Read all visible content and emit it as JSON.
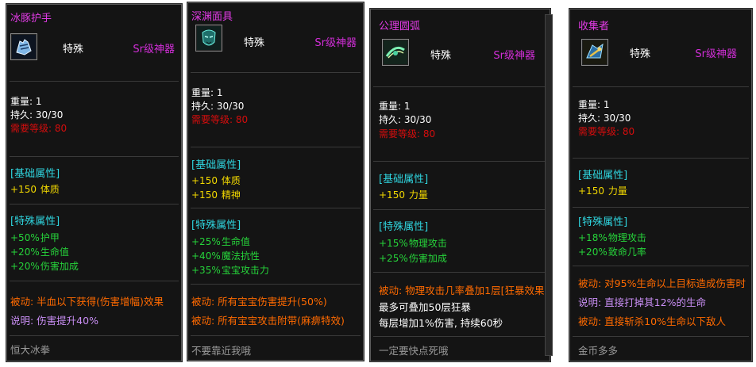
{
  "cards": [
    {
      "title": "冰豚护手",
      "icon": "glove-icon",
      "type": "特殊",
      "rarity": "Sr级神器",
      "weight": "重量: 1",
      "durability": "持久: 30/30",
      "level_req": "需要等级:  80",
      "base_header": "[基础属性]",
      "base_stats": [
        {
          "value": "+150",
          "label": "体质"
        }
      ],
      "special_header": "[特殊属性]",
      "special_stats": [
        {
          "value": "+50%",
          "label": "护甲"
        },
        {
          "value": "+20%",
          "label": "生命值"
        },
        {
          "value": "+20%",
          "label": "伤害加成"
        }
      ],
      "effects": [
        {
          "kind": "orange",
          "text": "被动: 半血以下获得(伤害增幅)效果"
        },
        {
          "kind": "lav",
          "text": "说明: 伤害提升40%"
        }
      ],
      "flavor": "恒大冰拳"
    },
    {
      "title": "深渊面具",
      "icon": "mask-icon",
      "type": "特殊",
      "rarity": "Sr级神器",
      "weight": "重量: 1",
      "durability": "持久: 30/30",
      "level_req": "需要等级:  80",
      "base_header": "[基础属性]",
      "base_stats": [
        {
          "value": "+150",
          "label": "体质"
        },
        {
          "value": "+150",
          "label": "精神"
        }
      ],
      "special_header": "[特殊属性]",
      "special_stats": [
        {
          "value": "+25%",
          "label": "生命值"
        },
        {
          "value": "+40%",
          "label": "魔法抗性"
        },
        {
          "value": "+35%",
          "label": "宝宝攻击力"
        }
      ],
      "effects": [
        {
          "kind": "orange",
          "text": "被动: 所有宝宝伤害提升(50%)"
        },
        {
          "kind": "orange",
          "text": "被动: 所有宝宝攻击附带(麻痹特效)"
        }
      ],
      "flavor": "不要靠近我哦"
    },
    {
      "title": "公理圆弧",
      "icon": "arc-icon",
      "type": "特殊",
      "rarity": "Sr级神器",
      "weight": "重量: 1",
      "durability": "持久: 30/30",
      "level_req": "需要等级:  80",
      "base_header": "[基础属性]",
      "base_stats": [
        {
          "value": "+150",
          "label": "力量"
        }
      ],
      "special_header": "[特殊属性]",
      "special_stats": [
        {
          "value": "+15%",
          "label": "物理攻击"
        },
        {
          "value": "+25%",
          "label": "伤害加成"
        }
      ],
      "effects": [
        {
          "kind": "orange",
          "text": "被动: 物理攻击几率叠加1层[狂暴效果]"
        },
        {
          "kind": "w",
          "text": "最多可叠加50层狂暴"
        },
        {
          "kind": "w",
          "text": "每层增加1%伤害, 持续60秒"
        }
      ],
      "flavor": "一定要快点死哦"
    },
    {
      "title": "收集者",
      "icon": "collector-icon",
      "type": "特殊",
      "rarity": "Sr级神器",
      "weight": "重量: 1",
      "durability": "持久: 30/30",
      "level_req": "需要等级:  80",
      "base_header": "[基础属性]",
      "base_stats": [
        {
          "value": "+150",
          "label": "力量"
        }
      ],
      "special_header": "[特殊属性]",
      "special_stats": [
        {
          "value": "+18%",
          "label": "物理攻击"
        },
        {
          "value": "+20%",
          "label": "致命几率"
        }
      ],
      "effects": [
        {
          "kind": "orange",
          "text": "被动: 对95%生命以上目标造成伤害时"
        },
        {
          "kind": "lav",
          "text": "说明: 直接打掉其12%的生命"
        },
        {
          "kind": "orange",
          "text": "被动: 直接斩杀10%生命以下敌人"
        }
      ],
      "flavor": "金币多多"
    }
  ]
}
